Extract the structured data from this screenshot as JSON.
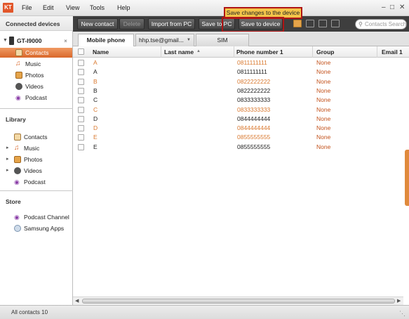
{
  "app": {
    "logo_text": "KT"
  },
  "menu": [
    "File",
    "Edit",
    "View",
    "Tools",
    "Help"
  ],
  "sidebar": {
    "connected_header": "Connected devices",
    "device": {
      "name": "GT-I9000",
      "close_glyph": "×"
    },
    "device_items": [
      {
        "label": "Contacts",
        "icon": "contacts-icon",
        "selected": true
      },
      {
        "label": "Music",
        "icon": "music-icon"
      },
      {
        "label": "Photos",
        "icon": "photos-icon"
      },
      {
        "label": "Videos",
        "icon": "videos-icon"
      },
      {
        "label": "Podcast",
        "icon": "podcast-icon"
      }
    ],
    "library_header": "Library",
    "library_items": [
      {
        "label": "Contacts",
        "icon": "contacts-icon"
      },
      {
        "label": "Music",
        "icon": "music-icon",
        "expandable": true
      },
      {
        "label": "Photos",
        "icon": "photos-icon",
        "expandable": true
      },
      {
        "label": "Videos",
        "icon": "videos-icon",
        "expandable": true
      },
      {
        "label": "Podcast",
        "icon": "podcast-icon"
      }
    ],
    "store_header": "Store",
    "store_items": [
      {
        "label": "Podcast Channel",
        "icon": "podcast-channel-icon"
      },
      {
        "label": "Samsung Apps",
        "icon": "samsung-apps-icon"
      }
    ]
  },
  "toolbar": {
    "new_contact": "New contact",
    "delete": "Delete",
    "import_from_pc": "Import from PC",
    "save_to_pc": "Save to PC",
    "save_to_device": "Save to device",
    "search_placeholder": "Contacts Search"
  },
  "tooltip": "Save changes to the device",
  "tabs": [
    {
      "label": "Mobile phone",
      "active": true
    },
    {
      "label": "hhp.tse@gmail...",
      "dropdown": true
    },
    {
      "label": "SIM"
    }
  ],
  "columns": [
    "Name",
    "Last name",
    "Phone number 1",
    "Group",
    "Email 1"
  ],
  "rows": [
    {
      "name": "A",
      "phone": "0811111111",
      "group": "None",
      "highlight": true
    },
    {
      "name": "A",
      "phone": "0811111111",
      "group": "None",
      "highlight": false
    },
    {
      "name": "B",
      "phone": "0822222222",
      "group": "None",
      "highlight": true
    },
    {
      "name": "B",
      "phone": "0822222222",
      "group": "None",
      "highlight": false
    },
    {
      "name": "C",
      "phone": "0833333333",
      "group": "None",
      "highlight": false
    },
    {
      "name": "C",
      "phone": "0833333333",
      "group": "None",
      "highlight": true
    },
    {
      "name": "D",
      "phone": "0844444444",
      "group": "None",
      "highlight": false
    },
    {
      "name": "D",
      "phone": "0844444444",
      "group": "None",
      "highlight": true
    },
    {
      "name": "E",
      "phone": "0855555555",
      "group": "None",
      "highlight": true
    },
    {
      "name": "E",
      "phone": "0855555555",
      "group": "None",
      "highlight": false
    }
  ],
  "status": {
    "text": "All contacts 10"
  },
  "colors": {
    "accent": "#d9672a",
    "phone_orange": "#d9782e",
    "group_orange": "#c4531d",
    "toolbar_bg": "#3e3e3e",
    "tooltip_bg": "#f4c54a",
    "annotation_red": "#b01515"
  }
}
